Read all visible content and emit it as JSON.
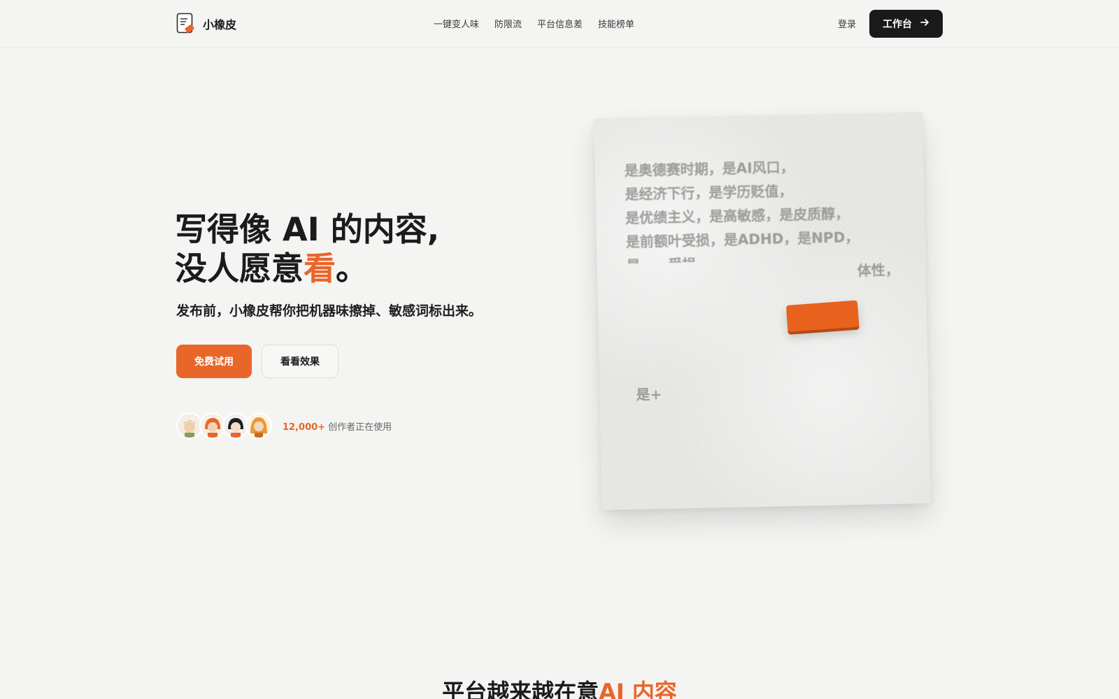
{
  "header": {
    "logo_text": "小橡皮",
    "nav": [
      "一键变人味",
      "防限流",
      "平台信息差",
      "技能榜单"
    ],
    "login": "登录",
    "workbench": "工作台"
  },
  "hero": {
    "title_line1": "写得像 AI 的内容,",
    "title_line2_prefix": "没人愿意",
    "title_line2_accent": "看",
    "title_line2_suffix": "。",
    "subtitle": "发布前，小橡皮帮你把机器味擦掉、敏感词标出来。",
    "primary_button": "免费试用",
    "secondary_button": "看看效果",
    "user_count": "12,000+",
    "user_text": "创作者正在使用"
  },
  "paper": {
    "lines": [
      "是奥德赛时期，是AI风口，",
      "是经济下行，是学历贬值，",
      "是优绩主义，是高敏感，是皮质醇，",
      "是前额叶受损，是ADHD，是NPD，",
      "是……受损，"
    ],
    "partial_line": "体性，",
    "footer": "是+"
  },
  "section": {
    "title_prefix": "平台越来越在意",
    "title_accent": "AI 内容"
  },
  "colors": {
    "accent": "#e8662a",
    "dark": "#1a1a1a",
    "background": "#f4f4f2"
  }
}
